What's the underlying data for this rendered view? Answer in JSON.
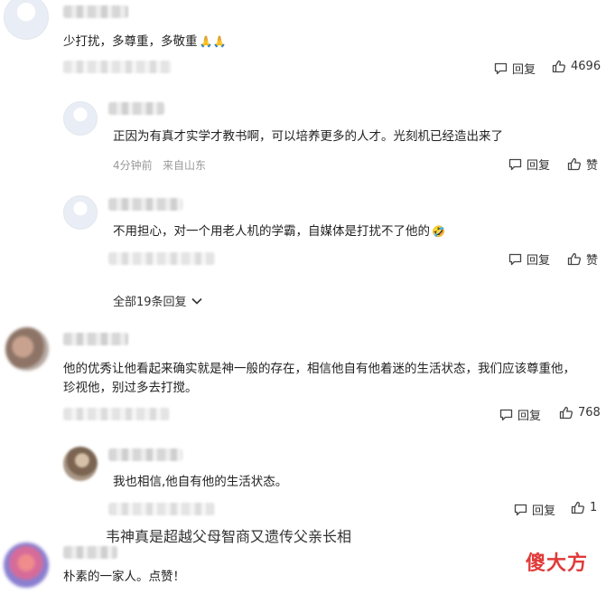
{
  "comments": [
    {
      "text": "少打扰，多尊重，多敬重",
      "emoji": "🙏🙏",
      "reply_label": "回复",
      "like_count": "4696"
    },
    {
      "text": "正因为有真才实学才教书啊，可以培养更多的人才。光刻机已经造出来了",
      "time": "4分钟前",
      "location": "来自山东",
      "reply_label": "回复",
      "like_label": "赞"
    },
    {
      "text": "不用担心，对一个用老人机的学霸，自媒体是打扰不了他的",
      "emoji": "🤣",
      "reply_label": "回复",
      "like_label": "赞"
    },
    {
      "text_line1": "他的优秀让他看起来确实就是神一般的存在，相信他自有他着迷的生活状态，我们应该尊重他，",
      "text_line2": "珍视他，别过多去打搅。",
      "reply_label": "回复",
      "like_count": "768"
    },
    {
      "text": "我也相信,他自有他的生活状态。",
      "reply_label": "回复",
      "like_count": "1"
    },
    {
      "text": "朴素的一家人。点赞！"
    }
  ],
  "expand_replies": "全部19条回复",
  "caption": "韦神真是超越父母智商又遗传父亲长相",
  "watermark": "傻大方",
  "colors": {
    "watermark": "#e03a3a",
    "meta": "#999999",
    "text": "#222222"
  }
}
